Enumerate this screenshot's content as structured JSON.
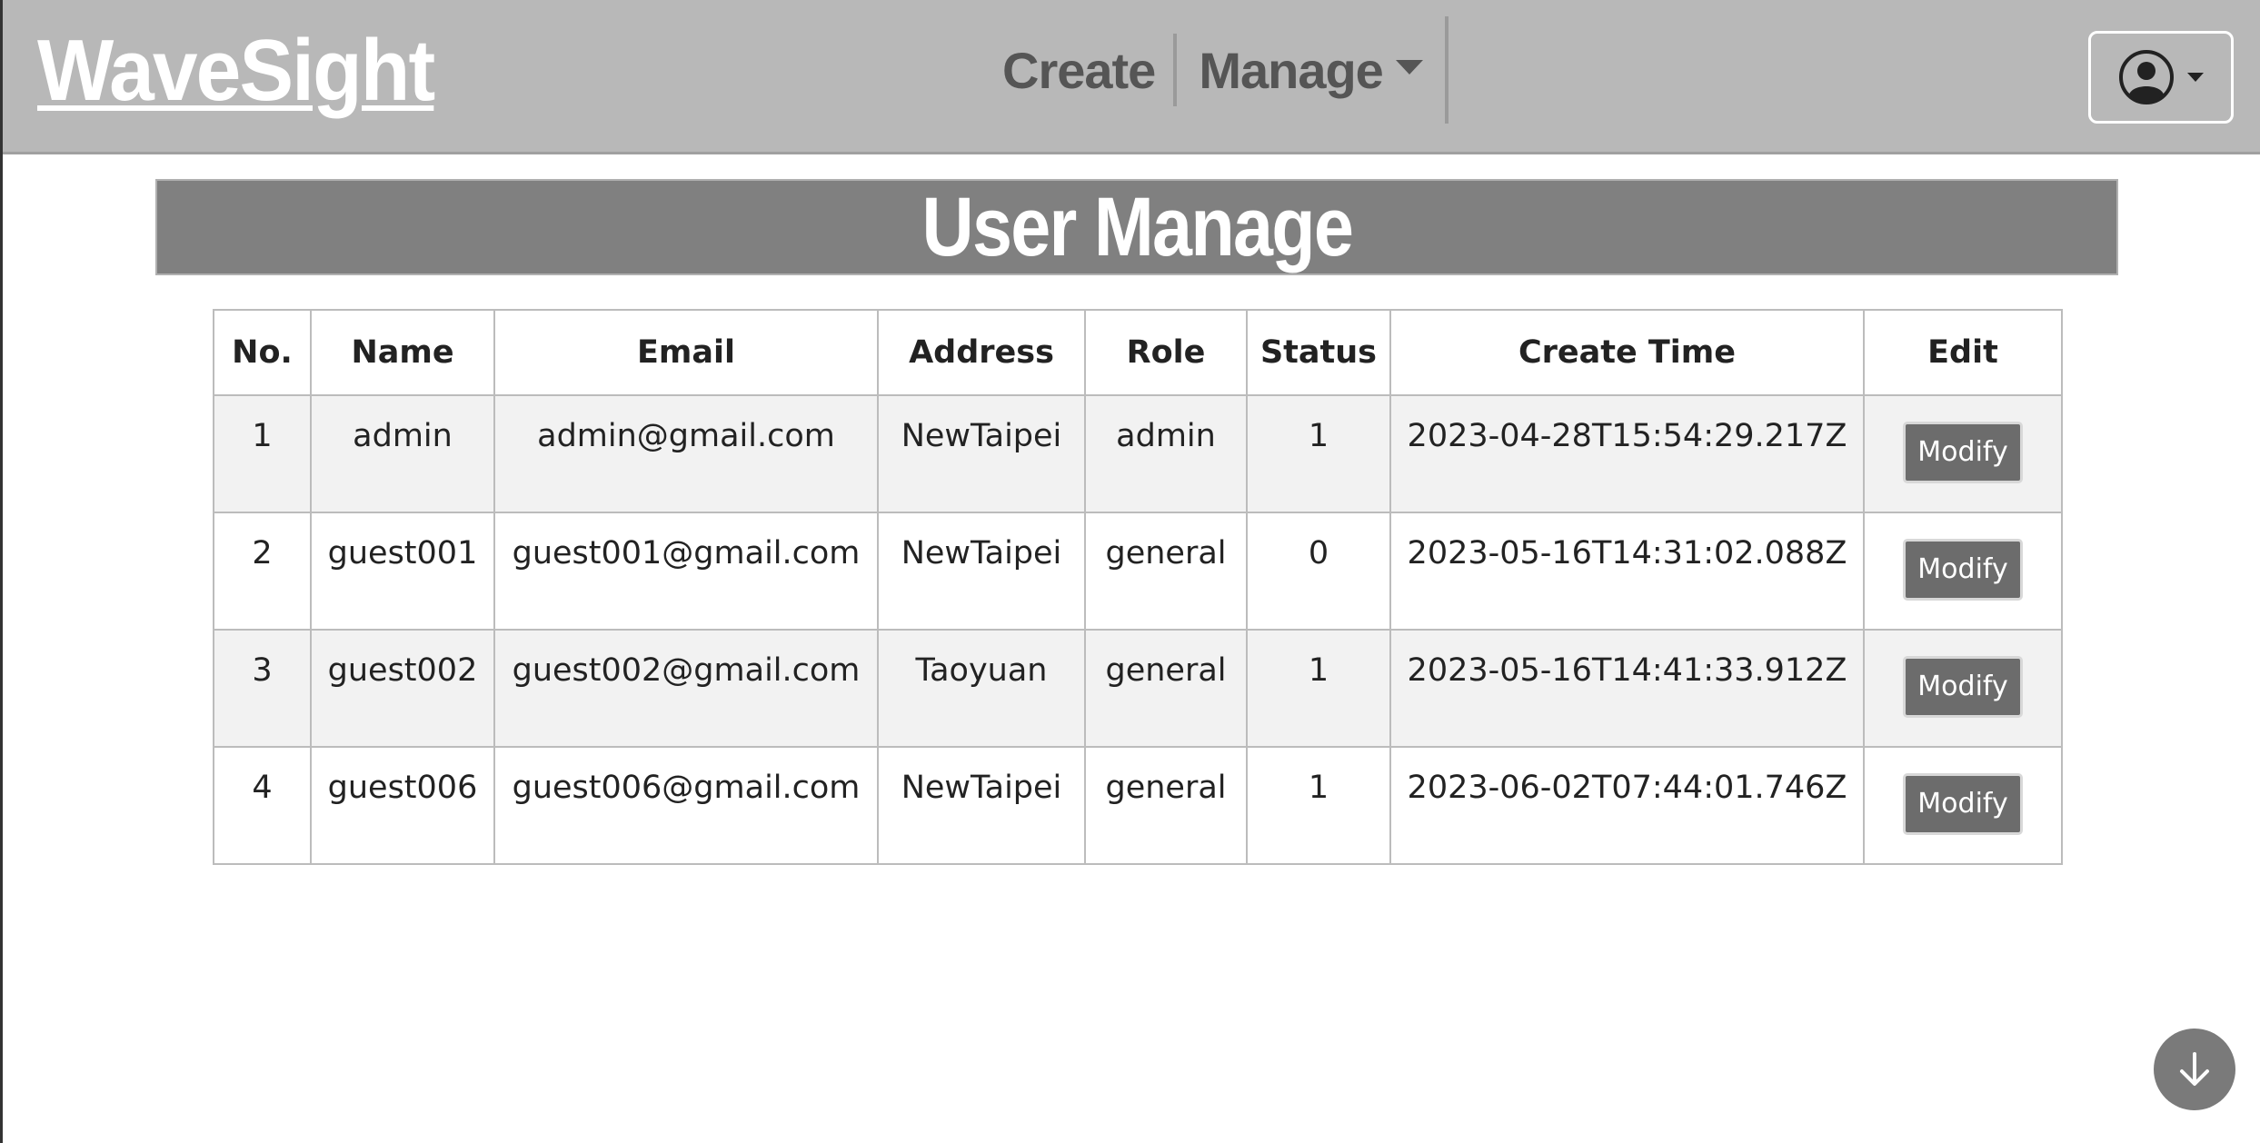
{
  "brand": {
    "name": "WaveSight"
  },
  "nav": {
    "create_label": "Create",
    "manage_label": "Manage"
  },
  "user_menu": {
    "icon": "user-circle-icon"
  },
  "page": {
    "title": "User Manage"
  },
  "table": {
    "headers": [
      "No.",
      "Name",
      "Email",
      "Address",
      "Role",
      "Status",
      "Create Time",
      "Edit"
    ],
    "rows": [
      {
        "no": "1",
        "name": "admin",
        "email": "admin@gmail.com",
        "address": "NewTaipei",
        "role": "admin",
        "status": "1",
        "create_time": "2023-04-28T15:54:29.217Z",
        "edit": "Modify"
      },
      {
        "no": "2",
        "name": "guest001",
        "email": "guest001@gmail.com",
        "address": "NewTaipei",
        "role": "general",
        "status": "0",
        "create_time": "2023-05-16T14:31:02.088Z",
        "edit": "Modify"
      },
      {
        "no": "3",
        "name": "guest002",
        "email": "guest002@gmail.com",
        "address": "Taoyuan",
        "role": "general",
        "status": "1",
        "create_time": "2023-05-16T14:41:33.912Z",
        "edit": "Modify"
      },
      {
        "no": "4",
        "name": "guest006",
        "email": "guest006@gmail.com",
        "address": "NewTaipei",
        "role": "general",
        "status": "1",
        "create_time": "2023-06-02T07:44:01.746Z",
        "edit": "Modify"
      }
    ]
  },
  "scroll_button": {
    "icon": "arrow-down-icon"
  },
  "colors": {
    "navbar": "#b8b8b8",
    "banner": "#808080",
    "button": "#6c6c6c",
    "row_stripe": "#f2f2f2"
  }
}
